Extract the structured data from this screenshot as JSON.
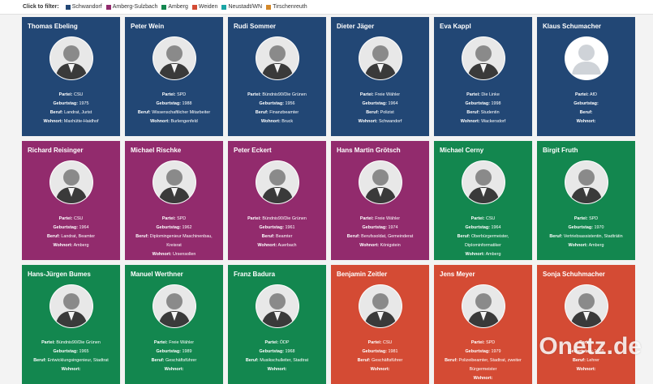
{
  "filter": {
    "label": "Click to filter:",
    "options": [
      {
        "label": "Schwandorf",
        "color": "#224775"
      },
      {
        "label": "Amberg-Sulzbach",
        "color": "#922b6d"
      },
      {
        "label": "Amberg",
        "color": "#13874f"
      },
      {
        "label": "Weiden",
        "color": "#d44b34"
      },
      {
        "label": "Neustadt/WN",
        "color": "#1aa6a6"
      },
      {
        "label": "Tirschenreuth",
        "color": "#d4892a"
      }
    ]
  },
  "labels": {
    "partei": "Partei:",
    "geburtstag": "Geburtstag:",
    "beruf": "Beruf:",
    "wohnort": "Wohnort:"
  },
  "candidates": [
    {
      "name": "Thomas Ebeling",
      "region": "sch",
      "partei": "CSU",
      "geburtstag": "1975",
      "beruf": "Landrat, Jurist",
      "wohnort": "Maxhütte-Haidhof"
    },
    {
      "name": "Peter Wein",
      "region": "sch",
      "partei": "SPD",
      "geburtstag": "1988",
      "beruf": "Wissenschaftlicher Mitarbeiter",
      "wohnort": "Burlengenfeld"
    },
    {
      "name": "Rudi Sommer",
      "region": "sch",
      "partei": "Bündnis90/Die Grünen",
      "geburtstag": "1956",
      "beruf": "Finanzbeamter",
      "wohnort": "Bruck"
    },
    {
      "name": "Dieter Jäger",
      "region": "sch",
      "partei": "Freie Wähler",
      "geburtstag": "1964",
      "beruf": "Polizist",
      "wohnort": "Schwandorf"
    },
    {
      "name": "Eva Kappl",
      "region": "sch",
      "partei": "Die Linke",
      "geburtstag": "1998",
      "beruf": "Studentin",
      "wohnort": "Wackersdorf"
    },
    {
      "name": "Klaus Schumacher",
      "region": "sch",
      "partei": "AfD",
      "geburtstag": "",
      "beruf": "",
      "wohnort": "",
      "placeholder": true
    },
    {
      "name": "Richard Reisinger",
      "region": "as",
      "partei": "CSU",
      "geburtstag": "1964",
      "beruf": "Landrat, Beamter",
      "wohnort": "Amberg"
    },
    {
      "name": "Michael Rischke",
      "region": "as",
      "partei": "SPD",
      "geburtstag": "1962",
      "beruf": "Diplomingenieur Maschinenbau, Kreisrat",
      "wohnort": "Ursensollen"
    },
    {
      "name": "Peter Eckert",
      "region": "as",
      "partei": "Bündnis90/Die Grünen",
      "geburtstag": "1961",
      "beruf": "Beamter",
      "wohnort": "Auerbach"
    },
    {
      "name": "Hans Martin Grötsch",
      "region": "as",
      "partei": "Freie Wähler",
      "geburtstag": "1974",
      "beruf": "Berufssoldat, Gemeinderat",
      "wohnort": "Königstein"
    },
    {
      "name": "Michael Cerny",
      "region": "amb",
      "partei": "CSU",
      "geburtstag": "1964",
      "beruf": "Oberbürgermeister, Diplominformatiker",
      "wohnort": "Amberg"
    },
    {
      "name": "Birgit Fruth",
      "region": "amb",
      "partei": "SPD",
      "geburtstag": "1970",
      "beruf": "Vertriebsassistentin, Stadträtin",
      "wohnort": "Amberg"
    },
    {
      "name": "Hans-Jürgen Bumes",
      "region": "amb",
      "partei": "Bündnis90/Die Grünen",
      "geburtstag": "1965",
      "beruf": "Entwicklungsingenieur, Stadtrat",
      "wohnort": ""
    },
    {
      "name": "Manuel Werthner",
      "region": "amb",
      "partei": "Freie Wähler",
      "geburtstag": "1989",
      "beruf": "Geschäftsführer",
      "wohnort": ""
    },
    {
      "name": "Franz Badura",
      "region": "amb",
      "partei": "ÖDP",
      "geburtstag": "1968",
      "beruf": "Musikschulleiter, Stadtrat",
      "wohnort": ""
    },
    {
      "name": "Benjamin Zeitler",
      "region": "wei",
      "partei": "CSU",
      "geburtstag": "1981",
      "beruf": "Geschäftsführer",
      "wohnort": ""
    },
    {
      "name": "Jens Meyer",
      "region": "wei",
      "partei": "SPD",
      "geburtstag": "1979",
      "beruf": "Polizeibeamter, Stadtrat, zweiter Bürgermeister",
      "wohnort": ""
    },
    {
      "name": "Sonja Schuhmacher",
      "region": "wei",
      "partei": "",
      "geburtstag": "1959",
      "beruf": "Lehrer",
      "wohnort": ""
    }
  ],
  "watermark": "Onetz.de"
}
